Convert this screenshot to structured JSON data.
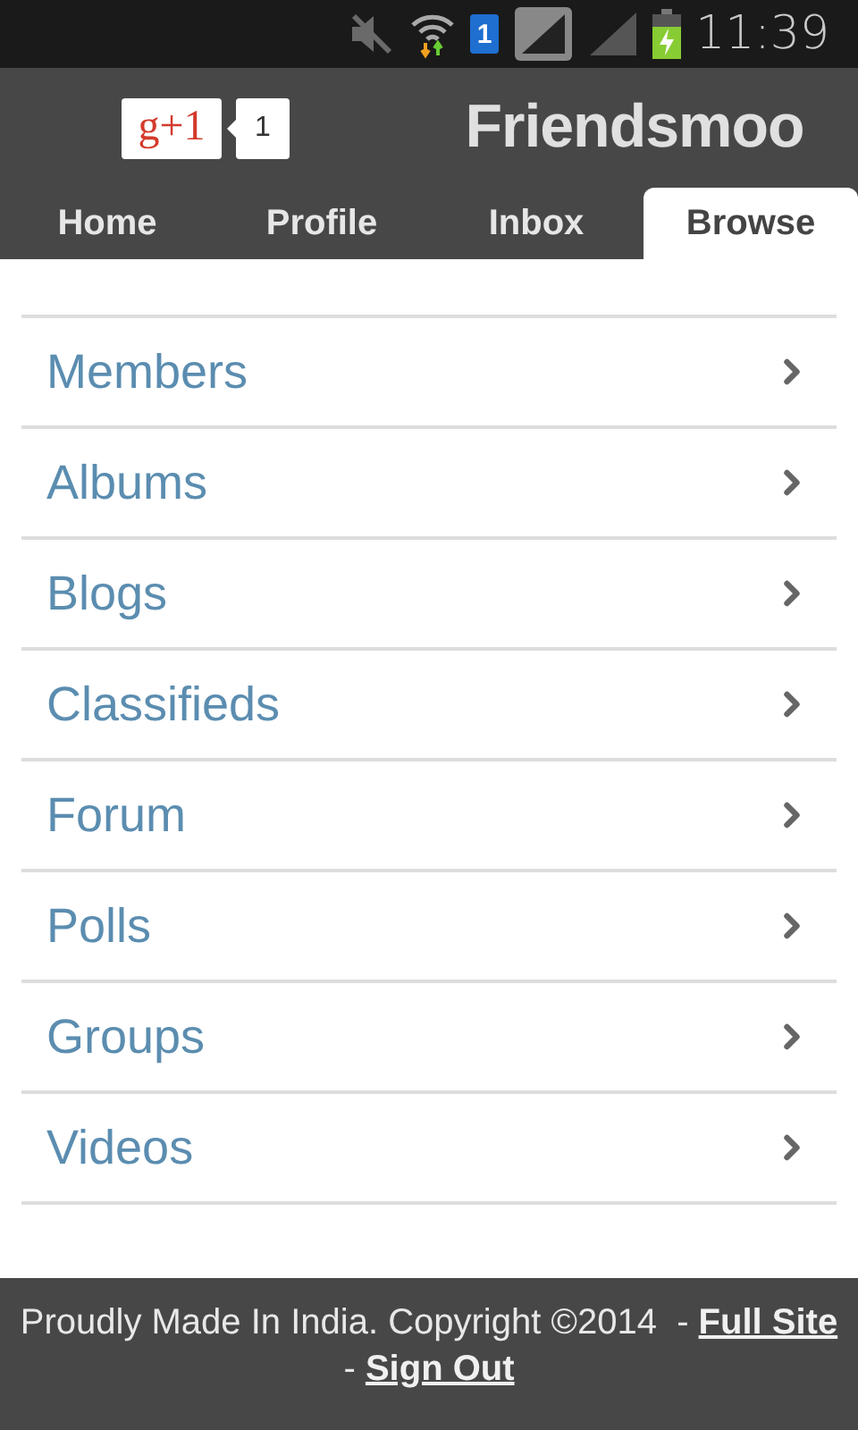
{
  "status_bar": {
    "time": "11:39",
    "sim": "1"
  },
  "header": {
    "plus_one": {
      "label": "g+1",
      "count": "1"
    },
    "title": "Friendsmoo"
  },
  "tabs": [
    {
      "label": "Home",
      "selected": false
    },
    {
      "label": "Profile",
      "selected": false
    },
    {
      "label": "Inbox",
      "selected": false
    },
    {
      "label": "Browse",
      "selected": true
    }
  ],
  "menu": [
    {
      "label": "Members"
    },
    {
      "label": "Albums"
    },
    {
      "label": "Blogs"
    },
    {
      "label": "Classifieds"
    },
    {
      "label": "Forum"
    },
    {
      "label": "Polls"
    },
    {
      "label": "Groups"
    },
    {
      "label": "Videos"
    }
  ],
  "footer": {
    "text": "Proudly Made In India. Copyright ©2014  -",
    "separator": "-",
    "links": [
      {
        "label": "Full Site"
      },
      {
        "label": "Sign Out"
      }
    ]
  }
}
